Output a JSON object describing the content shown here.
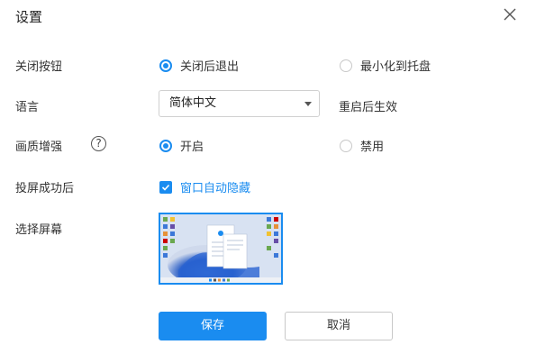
{
  "dialog": {
    "title": "设置",
    "close_icon": "close-icon"
  },
  "close_behavior": {
    "label": "关闭按钮",
    "options": [
      {
        "label": "关闭后退出",
        "selected": true
      },
      {
        "label": "最小化到托盘",
        "selected": false
      }
    ]
  },
  "language": {
    "label": "语言",
    "selected": "简体中文",
    "note": "重启后生效"
  },
  "quality": {
    "label": "画质增强",
    "help_symbol": "?",
    "options": [
      {
        "label": "开启",
        "selected": true
      },
      {
        "label": "禁用",
        "selected": false
      }
    ]
  },
  "after_cast": {
    "label": "投屏成功后",
    "checkbox_label": "窗口自动隐藏",
    "checked": true
  },
  "screen_select": {
    "label": "选择屏幕",
    "thumbnail": "screen-thumbnail"
  },
  "buttons": {
    "save": "保存",
    "cancel": "取消"
  },
  "colors": {
    "accent": "#1a8cf0",
    "text": "#333333",
    "border": "#c8c8c8"
  }
}
